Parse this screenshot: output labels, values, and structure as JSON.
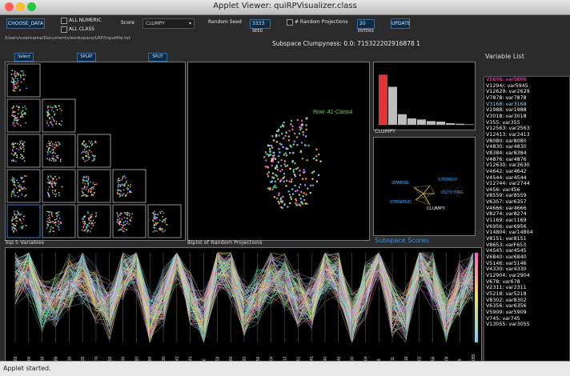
{
  "window": {
    "title": "Applet Viewer: quiRPVisualizer.class",
    "status": "Applet started."
  },
  "controls": {
    "choose_data": "CHOOSE_DATA",
    "filepath": "/Users/username/Documents/workspace/LRP/inputfile.txt",
    "checkbox_numeric_label": "ALL NUMERIC",
    "checkbox_class_label": "ALL CLASS",
    "score_label": "Score",
    "score_value": "CLUMPY",
    "random_seed_label": "Random Seed",
    "random_seed_value": "3333",
    "random_seed_sub": "SEED",
    "num_projections_label": "# Random Projections",
    "num_projections_value": "20",
    "num_projections_sub": "ENTERS",
    "update": "UPDATE",
    "scatter_buttons": [
      "Select",
      "SPLAT",
      "SPLIT"
    ]
  },
  "header": {
    "clumpyness": "Subspace Clumpyness: 0.0: 715322202916878 1"
  },
  "projection": {
    "label": "Row: 41-Class4"
  },
  "histogram": {
    "caption": "CLUMPY",
    "values": [
      0.95,
      0.72,
      0.2,
      0.12,
      0.1,
      0.07,
      0.06,
      0.03,
      0.02,
      0.01
    ]
  },
  "scores": {
    "caption": "Subspace Scores",
    "labels": [
      "SPARSE",
      "STRINGY",
      "OUTLYING",
      "STRIATED",
      "CLUMPY"
    ]
  },
  "captions": {
    "top_vars": "Top 5 Variables",
    "parallel": "Biplot of Random Projections"
  },
  "variable_list": {
    "title": "Variable List",
    "items": [
      {
        "text": "V5606: var5606",
        "color": "#ff6ad5"
      },
      {
        "text": "V1294/: var5945",
        "color": "#ffffff"
      },
      {
        "text": "V12629: var2629",
        "color": "#ffffff"
      },
      {
        "text": "V7878: var7878",
        "color": "#ffffff"
      },
      {
        "text": "V3168: var3168",
        "color": "#9fd8ff"
      },
      {
        "text": "V1988: var1988",
        "color": "#ffffff"
      },
      {
        "text": "V3018: var3018",
        "color": "#ffffff"
      },
      {
        "text": "V355: var355",
        "color": "#ffffff"
      },
      {
        "text": "V12563: var2563",
        "color": "#ffffff"
      },
      {
        "text": "V12413: var2413",
        "color": "#ffffff"
      },
      {
        "text": "V8080: var8080",
        "color": "#ffffff"
      },
      {
        "text": "V4830: var4830",
        "color": "#ffffff"
      },
      {
        "text": "V8384: var8384",
        "color": "#ffffff"
      },
      {
        "text": "V4876: var4876",
        "color": "#ffffff"
      },
      {
        "text": "V12630: var2630",
        "color": "#ffffff"
      },
      {
        "text": "V4642: var4642",
        "color": "#ffffff"
      },
      {
        "text": "V4544: var4544",
        "color": "#ffffff"
      },
      {
        "text": "V12744: var2744",
        "color": "#ffffff"
      },
      {
        "text": "V456: var456",
        "color": "#ffffff"
      },
      {
        "text": "V8559: var8559",
        "color": "#ffffff"
      },
      {
        "text": "V6357: var6357",
        "color": "#ffffff"
      },
      {
        "text": "V4666: var4666",
        "color": "#ffffff"
      },
      {
        "text": "V8274: var8274",
        "color": "#ffffff"
      },
      {
        "text": "V1169: var1169",
        "color": "#ffffff"
      },
      {
        "text": "V6956: var6956",
        "color": "#ffffff"
      },
      {
        "text": "V14804: var14804",
        "color": "#ffffff"
      },
      {
        "text": "V8151: var8151",
        "color": "#ffffff"
      },
      {
        "text": "V8653: varF653",
        "color": "#ffffff"
      },
      {
        "text": "V4545: var4545",
        "color": "#ffffff"
      },
      {
        "text": "V6840: var6840",
        "color": "#ffffff"
      },
      {
        "text": "V5146: var5146",
        "color": "#ffffff"
      },
      {
        "text": "V4330: var4330",
        "color": "#ffffff"
      },
      {
        "text": "V12904: var2904",
        "color": "#ffffff"
      },
      {
        "text": "V678: var678",
        "color": "#ffffff"
      },
      {
        "text": "V2311: var2311",
        "color": "#ffffff"
      },
      {
        "text": "V5218: var5218",
        "color": "#ffffff"
      },
      {
        "text": "V8302: var8302",
        "color": "#ffffff"
      },
      {
        "text": "V6356: var6356",
        "color": "#ffffff"
      },
      {
        "text": "V5909: var5909",
        "color": "#ffffff"
      },
      {
        "text": "V745: var745",
        "color": "#ffffff"
      },
      {
        "text": "V13055: var3055",
        "color": "#ffffff"
      }
    ]
  },
  "parallel_axes": [
    "V3168",
    "V5606",
    "V3018",
    "V1988",
    "V4516",
    "V8126",
    "V4876",
    "V1355",
    "V4830",
    "V8080",
    "V8384",
    "V2630",
    "V4642",
    "V2744",
    "V456",
    "V8559",
    "V4666",
    "V1169",
    "V6956",
    "V4804",
    "V2413",
    "V8151",
    "V4545",
    "V6840",
    "V5146",
    "V4330",
    "V2904",
    "V678",
    "V2311",
    "V5218",
    "V8302",
    "V6356",
    "V5909",
    "V745",
    "V13055"
  ]
}
